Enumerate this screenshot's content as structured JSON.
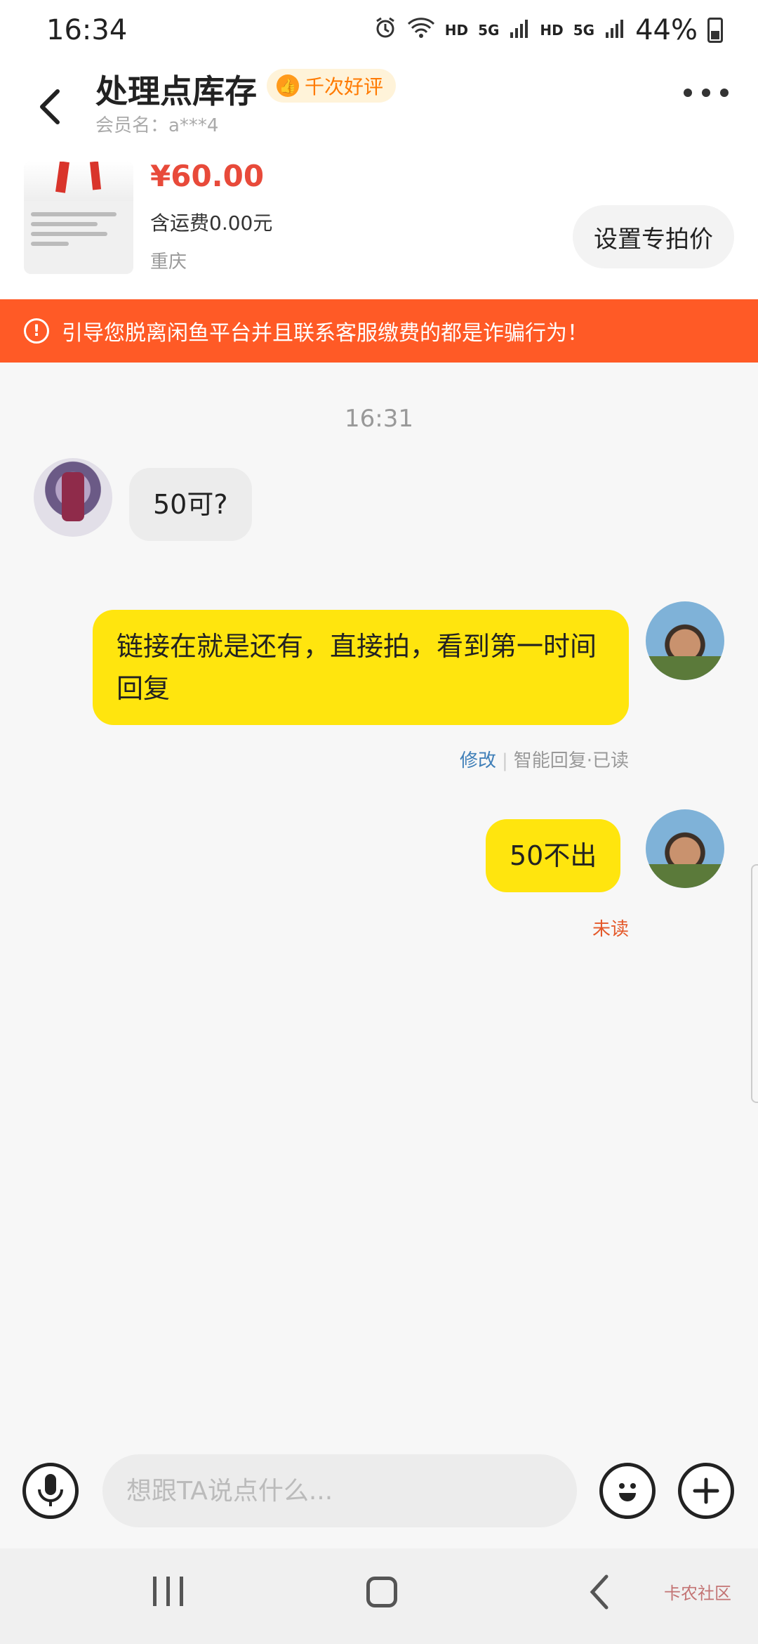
{
  "status_bar": {
    "time": "16:34",
    "hd1": "HD",
    "net1": "5G",
    "hd2": "HD",
    "net2": "5G",
    "battery": "44%"
  },
  "header": {
    "title": "处理点库存",
    "badge": "千次好评",
    "member": "会员名：a***4"
  },
  "product": {
    "price": "¥60.00",
    "shipping": "含运费0.00元",
    "location": "重庆",
    "special_price_button": "设置专拍价"
  },
  "warning": {
    "text": "引导您脱离闲鱼平台并且联系客服缴费的都是诈骗行为！"
  },
  "chat": {
    "timestamp": "16:31",
    "messages": [
      {
        "side": "left",
        "text": "50可?"
      },
      {
        "side": "right",
        "text": "链接在就是还有，直接拍，看到第一时间回复",
        "edit_label": "修改",
        "status": "智能回复·已读"
      },
      {
        "side": "right",
        "text": "50不出",
        "status": "未读"
      }
    ]
  },
  "input_bar": {
    "placeholder": "想跟TA说点什么..."
  },
  "watermark": "卡农社区"
}
